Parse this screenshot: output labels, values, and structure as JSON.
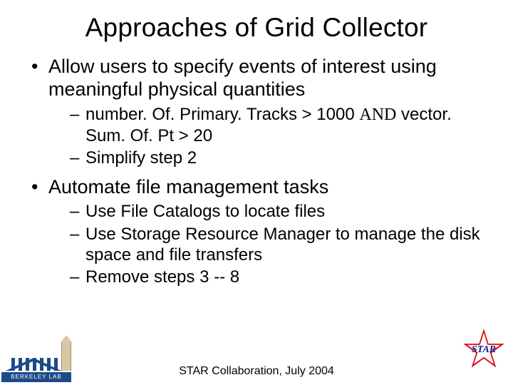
{
  "title": "Approaches of Grid Collector",
  "bullets": [
    {
      "text": "Allow users to specify events of interest using meaningful physical quantities",
      "sub": [
        {
          "pre": "number. Of. Primary. Tracks > 1000 ",
          "and": "AND",
          "post": " vector. Sum. Of. Pt > 20"
        },
        {
          "text": "Simplify step 2"
        }
      ]
    },
    {
      "text": "Automate file management tasks",
      "sub": [
        {
          "text": "Use File Catalogs to locate files"
        },
        {
          "text": "Use Storage Resource Manager to manage the disk space and file transfers"
        },
        {
          "text": "Remove steps 3 -- 8"
        }
      ]
    }
  ],
  "footer": "STAR Collaboration, July 2004",
  "logos": {
    "lbl_label": "BERKELEY LAB",
    "star_label": "STAR"
  }
}
